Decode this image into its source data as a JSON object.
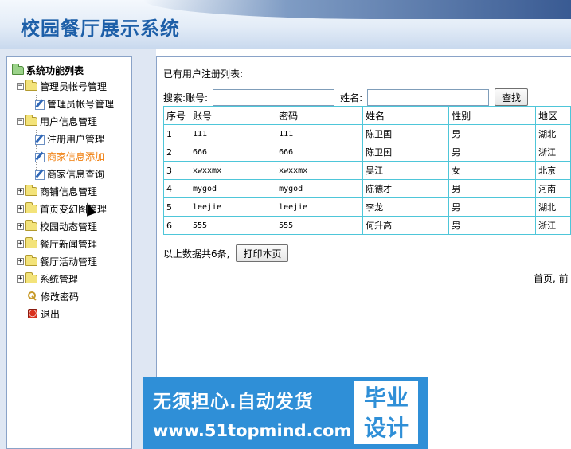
{
  "header": {
    "title": "校园餐厅展示系统"
  },
  "sidebar": {
    "root_label": "系统功能列表",
    "items": [
      {
        "label": "管理员帐号管理",
        "type": "folder",
        "expanded": true,
        "children": [
          {
            "label": "管理员帐号管理",
            "active": false
          }
        ]
      },
      {
        "label": "用户信息管理",
        "type": "folder",
        "expanded": true,
        "children": [
          {
            "label": "注册用户管理",
            "active": false
          },
          {
            "label": "商家信息添加",
            "active": true
          },
          {
            "label": "商家信息查询",
            "active": false
          }
        ]
      },
      {
        "label": "商铺信息管理",
        "type": "folder",
        "expanded": false
      },
      {
        "label": "首页变幻图管理",
        "type": "folder",
        "expanded": false
      },
      {
        "label": "校园动态管理",
        "type": "folder",
        "expanded": false
      },
      {
        "label": "餐厅新闻管理",
        "type": "folder",
        "expanded": false
      },
      {
        "label": "餐厅活动管理",
        "type": "folder",
        "expanded": false
      },
      {
        "label": "系统管理",
        "type": "folder",
        "expanded": false
      },
      {
        "label": "修改密码",
        "type": "key"
      },
      {
        "label": "退出",
        "type": "exit"
      }
    ]
  },
  "main": {
    "list_title": "已有用户注册列表:",
    "search": {
      "account_label": "搜索:账号:",
      "account_value": "",
      "name_label": "姓名:",
      "name_value": "",
      "search_button": "查找"
    },
    "table": {
      "columns": [
        "序号",
        "账号",
        "密码",
        "姓名",
        "性别",
        "地区"
      ],
      "rows": [
        [
          "1",
          "111",
          "111",
          "陈卫国",
          "男",
          "湖北"
        ],
        [
          "2",
          "666",
          "666",
          "陈卫国",
          "男",
          "浙江"
        ],
        [
          "3",
          "xwxxmx",
          "xwxxmx",
          "吴江",
          "女",
          "北京"
        ],
        [
          "4",
          "mygod",
          "mygod",
          "陈德才",
          "男",
          "河南"
        ],
        [
          "5",
          "leejie",
          "leejie",
          "李龙",
          "男",
          "湖北"
        ],
        [
          "6",
          "555",
          "555",
          "何升高",
          "男",
          "浙江"
        ]
      ]
    },
    "summary_text": "以上数据共6条,",
    "print_button": "打印本页",
    "pager_text": "首页, 前"
  },
  "watermark": {
    "line1": "无须担心.自动发货",
    "line2": "www.51topmind.com",
    "badge_line1": "毕业",
    "badge_line2": "设计"
  },
  "colors": {
    "title_blue": "#1d5fa8",
    "active_orange": "#f07d0a",
    "table_border": "#4ec6d9",
    "watermark_blue": "#2f8fd7"
  }
}
